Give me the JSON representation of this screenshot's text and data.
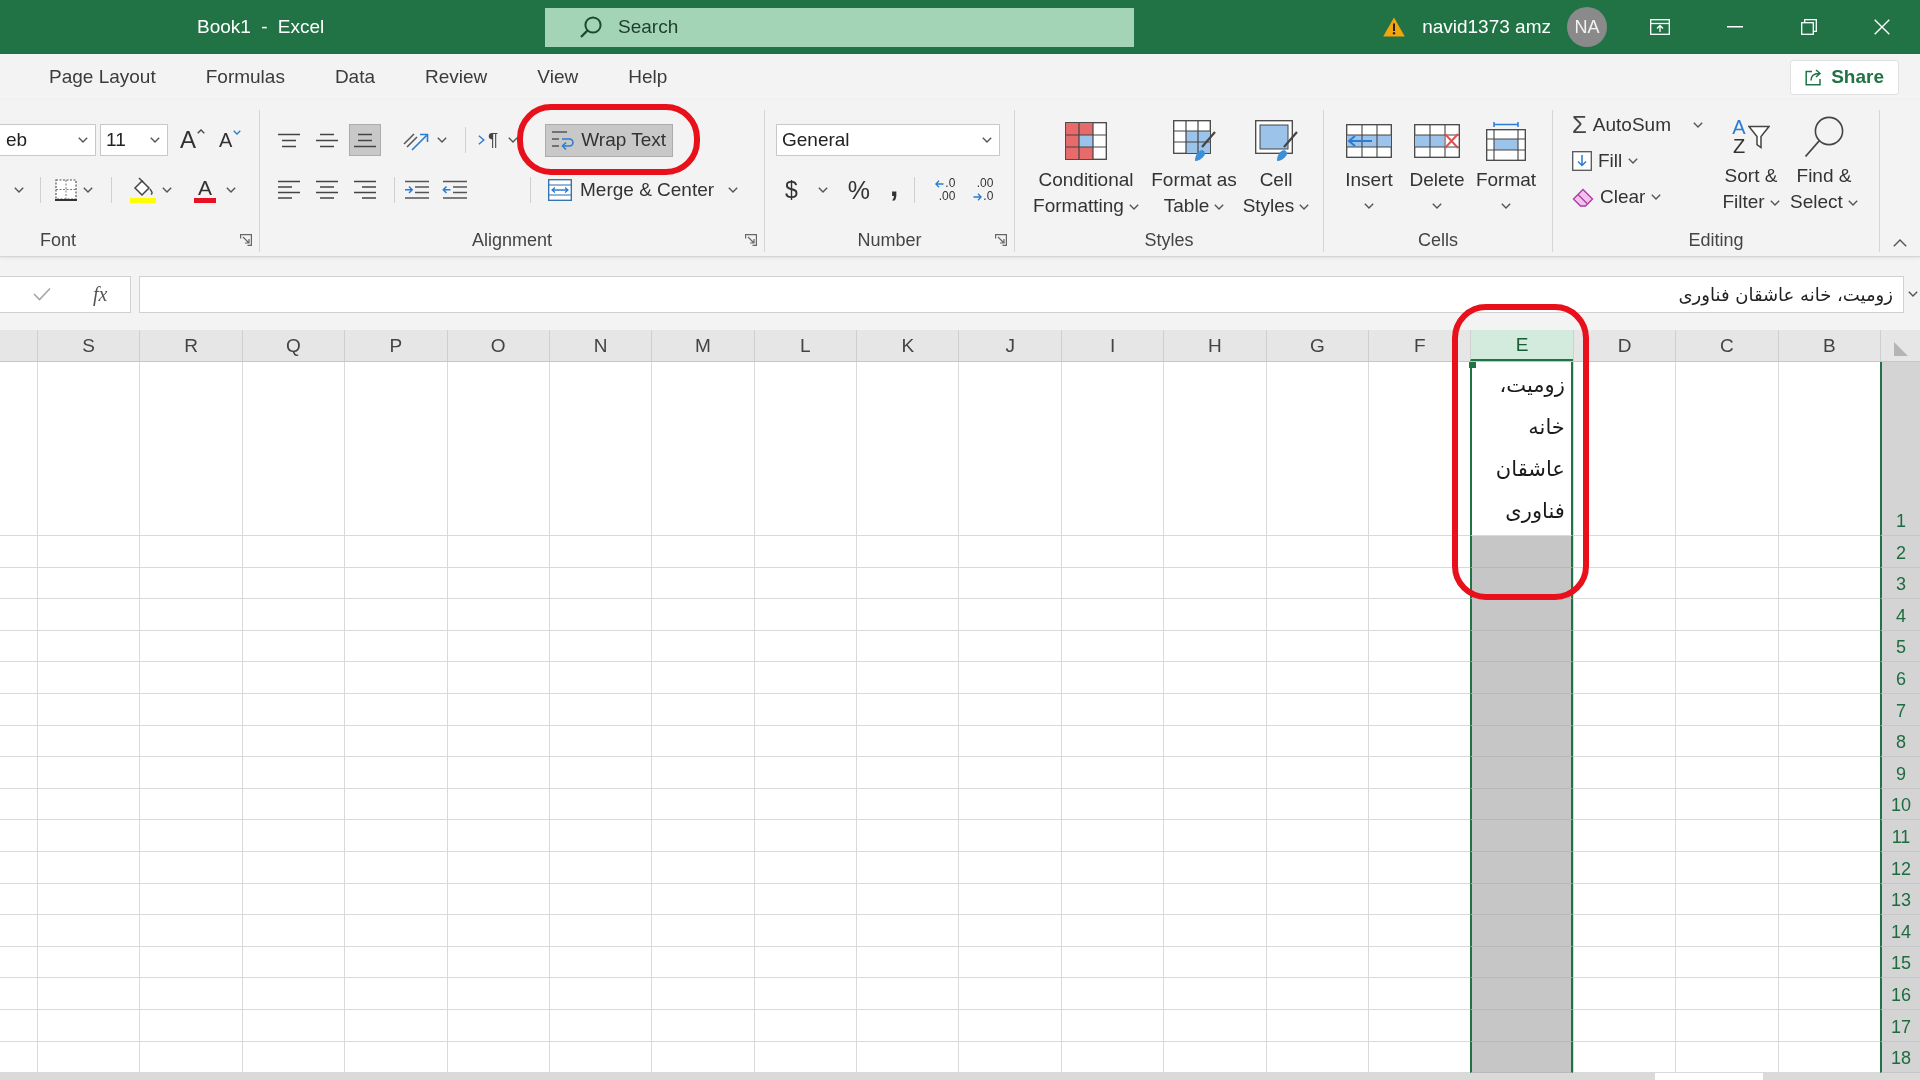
{
  "window": {
    "title": "Book1 - Excel",
    "search": {
      "placeholder": "Search"
    },
    "user": {
      "name": "navid1373 amz",
      "initials": "NA"
    }
  },
  "tabs": [
    {
      "label": "Page Layout",
      "selected": false
    },
    {
      "label": "Formulas",
      "selected": false
    },
    {
      "label": "Data",
      "selected": false
    },
    {
      "label": "Review",
      "selected": false
    },
    {
      "label": "View",
      "selected": false
    },
    {
      "label": "Help",
      "selected": false
    }
  ],
  "share_button": {
    "label": "Share"
  },
  "ribbon": {
    "font": {
      "label": "Font",
      "font_name": "eb",
      "font_size": "11",
      "grow_glyph": "A",
      "shrink_glyph": "A",
      "color_glyph": "A"
    },
    "alignment": {
      "label": "Alignment",
      "vertical": [
        {
          "selected": false
        },
        {
          "selected": false
        },
        {
          "selected": true
        }
      ],
      "horizontal": [
        {
          "selected": false
        },
        {
          "selected": false
        },
        {
          "selected": false
        }
      ],
      "direction_glyph": "¶",
      "wrap_text": {
        "label": "Wrap Text",
        "selected": true,
        "circled": true
      },
      "merge": {
        "label": "Merge & Center"
      }
    },
    "number": {
      "label": "Number",
      "format": "General",
      "currency": "$",
      "percent": "%",
      "comma": ",",
      "increase_decimal": [
        ".0",
        ".00"
      ],
      "decrease_decimal": [
        ".00",
        ".0"
      ]
    },
    "styles": {
      "label": "Styles",
      "buttons": [
        {
          "label": "Conditional Formatting"
        },
        {
          "label": "Format as Table"
        },
        {
          "label": "Cell Styles"
        }
      ]
    },
    "cells": {
      "label": "Cells",
      "buttons": [
        {
          "label": "Insert"
        },
        {
          "label": "Delete"
        },
        {
          "label": "Format"
        }
      ]
    },
    "editing": {
      "label": "Editing",
      "autosum": {
        "glyph": "Σ",
        "label": "AutoSum"
      },
      "fill": {
        "label": "Fill"
      },
      "clear": {
        "label": "Clear"
      },
      "sort_filter": {
        "glyphs": [
          "A",
          "Z"
        ],
        "label": "Sort & Filter"
      },
      "find_select": {
        "label": "Find & Select"
      }
    }
  },
  "formula_bar": {
    "function_glyph": "fx",
    "value": "زومیت، خانه عاشقان فناوری"
  },
  "sheet": {
    "columns": [
      {
        "label": "S",
        "selected": false
      },
      {
        "label": "R",
        "selected": false
      },
      {
        "label": "Q",
        "selected": false
      },
      {
        "label": "P",
        "selected": false
      },
      {
        "label": "O",
        "selected": false
      },
      {
        "label": "N",
        "selected": false
      },
      {
        "label": "M",
        "selected": false
      },
      {
        "label": "L",
        "selected": false
      },
      {
        "label": "K",
        "selected": false
      },
      {
        "label": "J",
        "selected": false
      },
      {
        "label": "I",
        "selected": false
      },
      {
        "label": "H",
        "selected": false
      },
      {
        "label": "G",
        "selected": false
      },
      {
        "label": "F",
        "selected": false
      },
      {
        "label": "E",
        "selected": true,
        "circled": true,
        "cells": [
          {
            "text": "زومیت، خانه عاشقان فناوری",
            "active": true
          }
        ]
      },
      {
        "label": "D",
        "selected": false
      },
      {
        "label": "C",
        "selected": false
      },
      {
        "label": "B",
        "selected": false
      }
    ],
    "rows": [
      "1",
      "2",
      "3",
      "4",
      "5",
      "6",
      "7",
      "8",
      "9",
      "10",
      "11",
      "12",
      "13",
      "14",
      "15",
      "16",
      "17",
      "18"
    ]
  }
}
